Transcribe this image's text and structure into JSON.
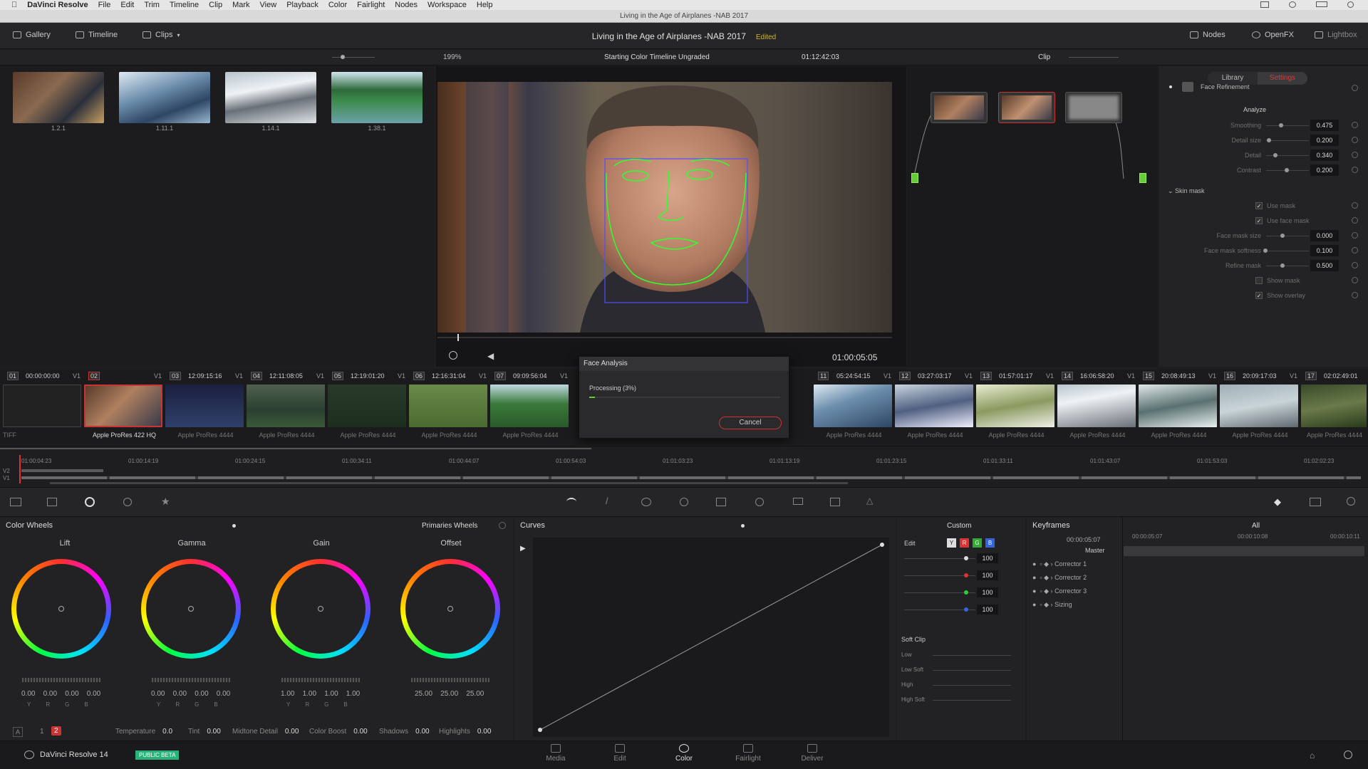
{
  "menubar": {
    "apple": "",
    "items": [
      "DaVinci Resolve",
      "File",
      "Edit",
      "Trim",
      "Timeline",
      "Clip",
      "Mark",
      "View",
      "Playback",
      "Color",
      "Fairlight",
      "Nodes",
      "Workspace",
      "Help"
    ]
  },
  "window_title": "Living in the Age of Airplanes -NAB 2017",
  "toolbar": {
    "gallery": "Gallery",
    "timeline": "Timeline",
    "clips": "Clips",
    "project_title": "Living in the Age of Airplanes -NAB 2017",
    "edited": "Edited",
    "nodes": "Nodes",
    "openfx": "OpenFX",
    "lightbox": "Lightbox"
  },
  "viewer_bar": {
    "zoom": "199%",
    "timeline_name": "Starting Color Timeline Ungraded",
    "timecode": "01:12:42:03",
    "clip_mode": "Clip"
  },
  "gallery": {
    "stills": [
      {
        "label": "1.2.1"
      },
      {
        "label": "1.11.1"
      },
      {
        "label": "1.14.1"
      },
      {
        "label": "1.38.1"
      }
    ]
  },
  "viewer": {
    "playhead_tc": "01:00:05:05"
  },
  "inspector": {
    "tab_library": "Library",
    "tab_settings": "Settings",
    "plugin": "Face Refinement",
    "analyze": "Analyze",
    "params": [
      {
        "name": "Smoothing",
        "value": "0.475"
      },
      {
        "name": "Detail size",
        "value": "0.200"
      },
      {
        "name": "Detail",
        "value": "0.340"
      },
      {
        "name": "Contrast",
        "value": "0.200"
      }
    ],
    "skin_mask": "Skin mask",
    "use_mask": "Use mask",
    "use_face_mask": "Use face mask",
    "mask_params": [
      {
        "name": "Face mask size",
        "value": "0.000"
      },
      {
        "name": "Face mask softness",
        "value": "0.100"
      },
      {
        "name": "Refine mask",
        "value": "0.500"
      }
    ],
    "show_mask": "Show mask",
    "show_overlay": "Show overlay"
  },
  "dialog": {
    "title": "Face Analysis",
    "status": "Processing (3%)",
    "progress": 0.03,
    "cancel": "Cancel"
  },
  "clips": [
    {
      "num": "01",
      "tc": "00:00:00:00",
      "track": "V1",
      "codec": "TIFF"
    },
    {
      "num": "02",
      "tc": "",
      "track": "V1",
      "codec": "Apple ProRes 422 HQ"
    },
    {
      "num": "03",
      "tc": "12:09:15:16",
      "track": "V1",
      "codec": "Apple ProRes 4444"
    },
    {
      "num": "04",
      "tc": "12:11:08:05",
      "track": "V1",
      "codec": "Apple ProRes 4444"
    },
    {
      "num": "05",
      "tc": "12:19:01:20",
      "track": "V1",
      "codec": "Apple ProRes 4444"
    },
    {
      "num": "06",
      "tc": "12:16:31:04",
      "track": "V1",
      "codec": "Apple ProRes 4444"
    },
    {
      "num": "07",
      "tc": "09:09:56:04",
      "track": "V1",
      "codec": "Apple ProRes 4444"
    },
    {
      "num": "11",
      "tc": "05:24:54:15",
      "track": "V1",
      "codec": "Apple ProRes 4444"
    },
    {
      "num": "12",
      "tc": "03:27:03:17",
      "track": "V1",
      "codec": "Apple ProRes 4444"
    },
    {
      "num": "13",
      "tc": "01:57:01:17",
      "track": "V1",
      "codec": "Apple ProRes 4444"
    },
    {
      "num": "14",
      "tc": "16:06:58:20",
      "track": "V1",
      "codec": "Apple ProRes 4444"
    },
    {
      "num": "15",
      "tc": "20:08:49:13",
      "track": "V1",
      "codec": "Apple ProRes 4444"
    },
    {
      "num": "16",
      "tc": "20:09:17:03",
      "track": "V1",
      "codec": "Apple ProRes 4444"
    },
    {
      "num": "17",
      "tc": "02:02:49:01",
      "track": "",
      "codec": "Apple ProRes 4444"
    }
  ],
  "timeline": {
    "ruler": [
      "01:00:04:23",
      "01:00:14:19",
      "01:00:24:15",
      "01:00:34:11",
      "01:00:44:07",
      "01:00:54:03",
      "01:01:03:23",
      "01:01:13:19",
      "01:01:23:15",
      "01:01:33:11",
      "01:01:43:07",
      "01:01:53:03",
      "01:02:02:23"
    ],
    "tracks": [
      "V2",
      "V1"
    ]
  },
  "color_wheels": {
    "title": "Color Wheels",
    "mode": "Primaries Wheels",
    "wheels": [
      {
        "name": "Lift",
        "values": [
          "0.00",
          "0.00",
          "0.00",
          "0.00"
        ]
      },
      {
        "name": "Gamma",
        "values": [
          "0.00",
          "0.00",
          "0.00",
          "0.00"
        ]
      },
      {
        "name": "Gain",
        "values": [
          "1.00",
          "1.00",
          "1.00",
          "1.00"
        ]
      },
      {
        "name": "Offset",
        "values": [
          "25.00",
          "25.00",
          "25.00"
        ]
      }
    ],
    "channel_labels": "YRGB",
    "page1": "1",
    "page2": "2",
    "params": [
      {
        "name": "Temperature",
        "value": "0.0"
      },
      {
        "name": "Tint",
        "value": "0.00"
      },
      {
        "name": "Midtone Detail",
        "value": "0.00"
      },
      {
        "name": "Color Boost",
        "value": "0.00"
      },
      {
        "name": "Shadows",
        "value": "0.00"
      },
      {
        "name": "Highlights",
        "value": "0.00"
      }
    ]
  },
  "curves": {
    "title": "Curves",
    "mode": "Custom",
    "edit": "Edit",
    "y": "Y",
    "r": "R",
    "g": "G",
    "b": "B",
    "values": [
      "100",
      "100",
      "100",
      "100"
    ],
    "soft_clip": "Soft Clip",
    "sc_labels": [
      "Low",
      "Low Soft",
      "High",
      "High Soft"
    ]
  },
  "keyframes": {
    "title": "Keyframes",
    "filter": "All",
    "tc": "00:00:05:07",
    "tc2": "00:00:10:08",
    "tc3": "00:00:10:11",
    "master": "Master",
    "tracks": [
      "Corrector 1",
      "Corrector 2",
      "Corrector 3",
      "Sizing"
    ]
  },
  "bottombar": {
    "app": "DaVinci Resolve 14",
    "beta": "PUBLIC BETA",
    "pages": [
      "Media",
      "Edit",
      "Color",
      "Fairlight",
      "Deliver"
    ],
    "active": "Color"
  }
}
